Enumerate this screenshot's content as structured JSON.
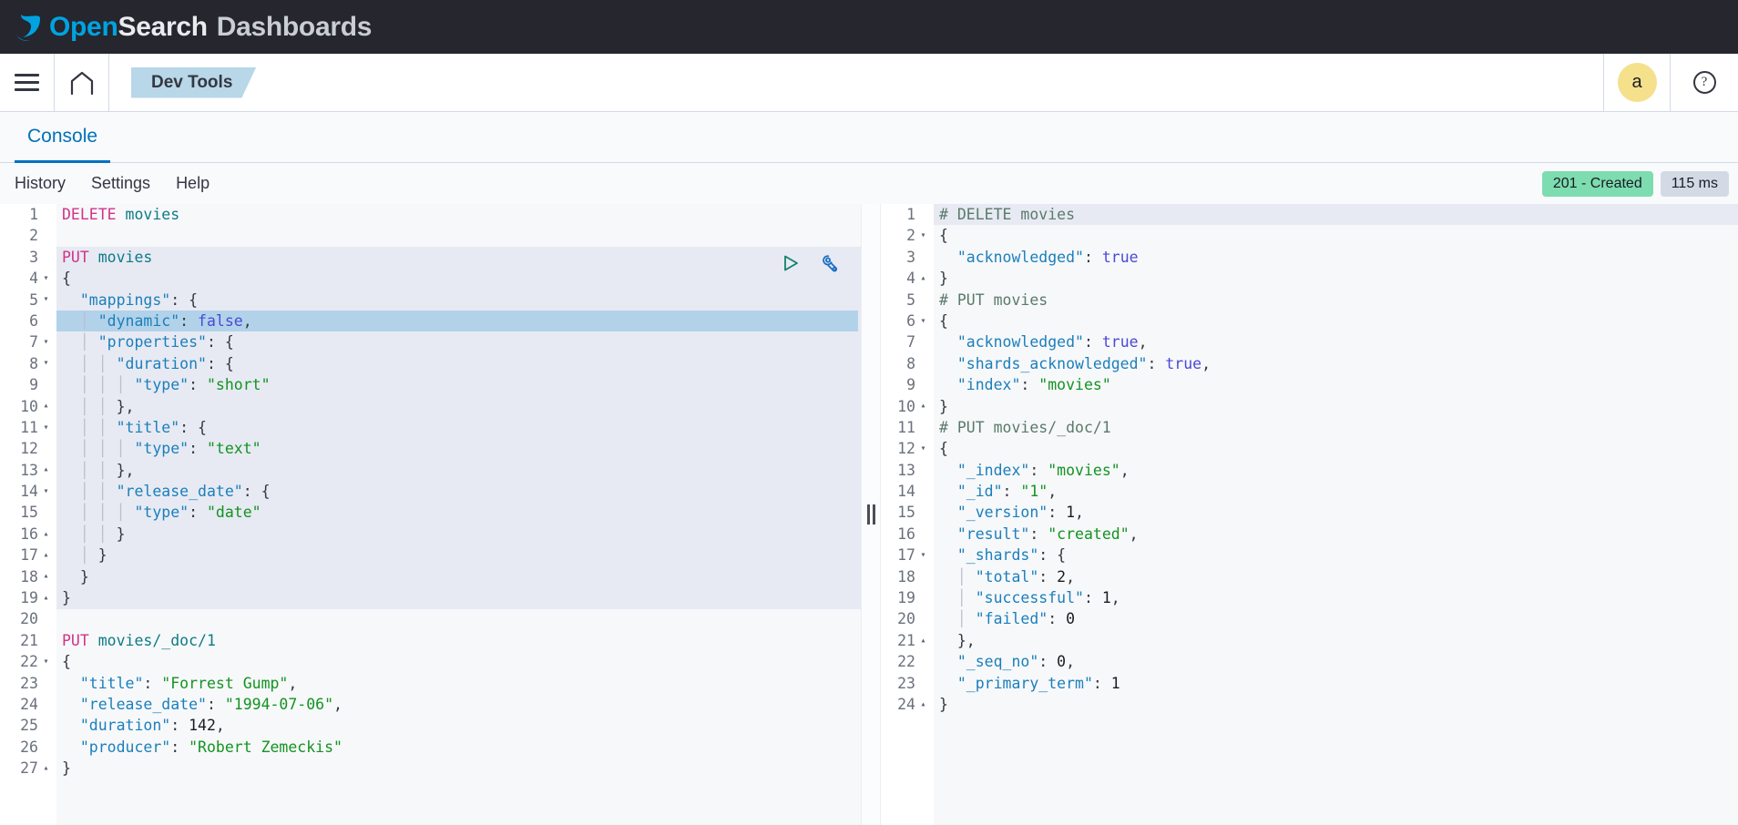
{
  "header": {
    "brand_open": "Open",
    "brand_search": "Search",
    "brand_dashboards": "Dashboards",
    "menu_icon": "hamburger-icon",
    "home_icon": "home-icon",
    "app_tab": "Dev Tools",
    "avatar_initial": "a",
    "help_icon": "question-mark-icon"
  },
  "tabs": [
    {
      "label": "Console",
      "active": true
    }
  ],
  "menu": {
    "items": [
      "History",
      "Settings",
      "Help"
    ],
    "status_badge": "201 - Created",
    "time_badge": "115 ms",
    "status_color": "#7ddcb0",
    "time_color": "#d3dae6"
  },
  "editor_actions": {
    "play_icon": "play-triangle-icon",
    "wrench_icon": "wrench-icon",
    "play_color": "#12806a",
    "wrench_color": "#1b6fc4"
  },
  "splitter": {
    "grip_icon": "drag-handle-icon"
  },
  "request_editor": {
    "name": "request-editor",
    "active_block_lines": [
      3,
      19
    ],
    "selected_line": 6,
    "active_gutter_line": 7,
    "lines": [
      {
        "n": 1,
        "fold": "",
        "tokens": [
          {
            "t": "DELETE",
            "c": "m"
          },
          {
            "t": " ",
            "c": "p"
          },
          {
            "t": "movies",
            "c": "u"
          }
        ]
      },
      {
        "n": 2,
        "fold": "",
        "tokens": []
      },
      {
        "n": 3,
        "fold": "",
        "tokens": [
          {
            "t": "PUT",
            "c": "m"
          },
          {
            "t": " ",
            "c": "p"
          },
          {
            "t": "movies",
            "c": "u"
          }
        ]
      },
      {
        "n": 4,
        "fold": "▾",
        "tokens": [
          {
            "t": "{",
            "c": "p"
          }
        ]
      },
      {
        "n": 5,
        "fold": "▾",
        "tokens": [
          {
            "t": "  ",
            "c": "p"
          },
          {
            "t": "\"mappings\"",
            "c": "k"
          },
          {
            "t": ": {",
            "c": "p"
          }
        ]
      },
      {
        "n": 6,
        "fold": "",
        "tokens": [
          {
            "t": "  ",
            "c": "p"
          },
          {
            "t": "│",
            "c": "ind"
          },
          {
            "t": " ",
            "c": "p"
          },
          {
            "t": "\"dynamic\"",
            "c": "k"
          },
          {
            "t": ": ",
            "c": "p"
          },
          {
            "t": "false",
            "c": "b"
          },
          {
            "t": ",",
            "c": "p"
          }
        ]
      },
      {
        "n": 7,
        "fold": "▾",
        "tokens": [
          {
            "t": "  ",
            "c": "p"
          },
          {
            "t": "│",
            "c": "ind"
          },
          {
            "t": " ",
            "c": "p"
          },
          {
            "t": "\"properties\"",
            "c": "k"
          },
          {
            "t": ": {",
            "c": "p"
          }
        ]
      },
      {
        "n": 8,
        "fold": "▾",
        "tokens": [
          {
            "t": "  ",
            "c": "p"
          },
          {
            "t": "│",
            "c": "ind"
          },
          {
            "t": " ",
            "c": "p"
          },
          {
            "t": "│",
            "c": "ind"
          },
          {
            "t": " ",
            "c": "p"
          },
          {
            "t": "\"duration\"",
            "c": "k"
          },
          {
            "t": ": {",
            "c": "p"
          }
        ]
      },
      {
        "n": 9,
        "fold": "",
        "tokens": [
          {
            "t": "  ",
            "c": "p"
          },
          {
            "t": "│",
            "c": "ind"
          },
          {
            "t": " ",
            "c": "p"
          },
          {
            "t": "│",
            "c": "ind"
          },
          {
            "t": " ",
            "c": "p"
          },
          {
            "t": "│",
            "c": "ind"
          },
          {
            "t": " ",
            "c": "p"
          },
          {
            "t": "\"type\"",
            "c": "k"
          },
          {
            "t": ": ",
            "c": "p"
          },
          {
            "t": "\"short\"",
            "c": "s"
          }
        ]
      },
      {
        "n": 10,
        "fold": "▴",
        "tokens": [
          {
            "t": "  ",
            "c": "p"
          },
          {
            "t": "│",
            "c": "ind"
          },
          {
            "t": " ",
            "c": "p"
          },
          {
            "t": "│",
            "c": "ind"
          },
          {
            "t": " ",
            "c": "p"
          },
          {
            "t": "},",
            "c": "p"
          }
        ]
      },
      {
        "n": 11,
        "fold": "▾",
        "tokens": [
          {
            "t": "  ",
            "c": "p"
          },
          {
            "t": "│",
            "c": "ind"
          },
          {
            "t": " ",
            "c": "p"
          },
          {
            "t": "│",
            "c": "ind"
          },
          {
            "t": " ",
            "c": "p"
          },
          {
            "t": "\"title\"",
            "c": "k"
          },
          {
            "t": ": {",
            "c": "p"
          }
        ]
      },
      {
        "n": 12,
        "fold": "",
        "tokens": [
          {
            "t": "  ",
            "c": "p"
          },
          {
            "t": "│",
            "c": "ind"
          },
          {
            "t": " ",
            "c": "p"
          },
          {
            "t": "│",
            "c": "ind"
          },
          {
            "t": " ",
            "c": "p"
          },
          {
            "t": "│",
            "c": "ind"
          },
          {
            "t": " ",
            "c": "p"
          },
          {
            "t": "\"type\"",
            "c": "k"
          },
          {
            "t": ": ",
            "c": "p"
          },
          {
            "t": "\"text\"",
            "c": "s"
          }
        ]
      },
      {
        "n": 13,
        "fold": "▴",
        "tokens": [
          {
            "t": "  ",
            "c": "p"
          },
          {
            "t": "│",
            "c": "ind"
          },
          {
            "t": " ",
            "c": "p"
          },
          {
            "t": "│",
            "c": "ind"
          },
          {
            "t": " ",
            "c": "p"
          },
          {
            "t": "},",
            "c": "p"
          }
        ]
      },
      {
        "n": 14,
        "fold": "▾",
        "tokens": [
          {
            "t": "  ",
            "c": "p"
          },
          {
            "t": "│",
            "c": "ind"
          },
          {
            "t": " ",
            "c": "p"
          },
          {
            "t": "│",
            "c": "ind"
          },
          {
            "t": " ",
            "c": "p"
          },
          {
            "t": "\"release_date\"",
            "c": "k"
          },
          {
            "t": ": {",
            "c": "p"
          }
        ]
      },
      {
        "n": 15,
        "fold": "",
        "tokens": [
          {
            "t": "  ",
            "c": "p"
          },
          {
            "t": "│",
            "c": "ind"
          },
          {
            "t": " ",
            "c": "p"
          },
          {
            "t": "│",
            "c": "ind"
          },
          {
            "t": " ",
            "c": "p"
          },
          {
            "t": "│",
            "c": "ind"
          },
          {
            "t": " ",
            "c": "p"
          },
          {
            "t": "\"type\"",
            "c": "k"
          },
          {
            "t": ": ",
            "c": "p"
          },
          {
            "t": "\"date\"",
            "c": "s"
          }
        ]
      },
      {
        "n": 16,
        "fold": "▴",
        "tokens": [
          {
            "t": "  ",
            "c": "p"
          },
          {
            "t": "│",
            "c": "ind"
          },
          {
            "t": " ",
            "c": "p"
          },
          {
            "t": "│",
            "c": "ind"
          },
          {
            "t": " ",
            "c": "p"
          },
          {
            "t": "}",
            "c": "p"
          }
        ]
      },
      {
        "n": 17,
        "fold": "▴",
        "tokens": [
          {
            "t": "  ",
            "c": "p"
          },
          {
            "t": "│",
            "c": "ind"
          },
          {
            "t": " ",
            "c": "p"
          },
          {
            "t": "}",
            "c": "p"
          }
        ]
      },
      {
        "n": 18,
        "fold": "▴",
        "tokens": [
          {
            "t": "  ",
            "c": "p"
          },
          {
            "t": "}",
            "c": "p"
          }
        ]
      },
      {
        "n": 19,
        "fold": "▴",
        "tokens": [
          {
            "t": "}",
            "c": "p"
          }
        ]
      },
      {
        "n": 20,
        "fold": "",
        "tokens": []
      },
      {
        "n": 21,
        "fold": "",
        "tokens": [
          {
            "t": "PUT",
            "c": "m"
          },
          {
            "t": " ",
            "c": "p"
          },
          {
            "t": "movies/_doc/1",
            "c": "u"
          }
        ]
      },
      {
        "n": 22,
        "fold": "▾",
        "tokens": [
          {
            "t": "{",
            "c": "p"
          }
        ]
      },
      {
        "n": 23,
        "fold": "",
        "tokens": [
          {
            "t": "  ",
            "c": "p"
          },
          {
            "t": "\"title\"",
            "c": "k"
          },
          {
            "t": ": ",
            "c": "p"
          },
          {
            "t": "\"Forrest Gump\"",
            "c": "s"
          },
          {
            "t": ",",
            "c": "p"
          }
        ]
      },
      {
        "n": 24,
        "fold": "",
        "tokens": [
          {
            "t": "  ",
            "c": "p"
          },
          {
            "t": "\"release_date\"",
            "c": "k"
          },
          {
            "t": ": ",
            "c": "p"
          },
          {
            "t": "\"1994-07-06\"",
            "c": "s"
          },
          {
            "t": ",",
            "c": "p"
          }
        ]
      },
      {
        "n": 25,
        "fold": "",
        "tokens": [
          {
            "t": "  ",
            "c": "p"
          },
          {
            "t": "\"duration\"",
            "c": "k"
          },
          {
            "t": ": ",
            "c": "p"
          },
          {
            "t": "142",
            "c": "n"
          },
          {
            "t": ",",
            "c": "p"
          }
        ]
      },
      {
        "n": 26,
        "fold": "",
        "tokens": [
          {
            "t": "  ",
            "c": "p"
          },
          {
            "t": "\"producer\"",
            "c": "k"
          },
          {
            "t": ": ",
            "c": "p"
          },
          {
            "t": "\"Robert Zemeckis\"",
            "c": "s"
          }
        ]
      },
      {
        "n": 27,
        "fold": "▴",
        "tokens": [
          {
            "t": "}",
            "c": "p"
          }
        ]
      }
    ]
  },
  "response_editor": {
    "name": "response-editor",
    "highlight_line": 1,
    "lines": [
      {
        "n": 1,
        "fold": "",
        "tokens": [
          {
            "t": "# DELETE movies",
            "c": "c"
          }
        ]
      },
      {
        "n": 2,
        "fold": "▾",
        "tokens": [
          {
            "t": "{",
            "c": "p"
          }
        ]
      },
      {
        "n": 3,
        "fold": "",
        "tokens": [
          {
            "t": "  ",
            "c": "p"
          },
          {
            "t": "\"acknowledged\"",
            "c": "k"
          },
          {
            "t": ": ",
            "c": "p"
          },
          {
            "t": "true",
            "c": "b"
          }
        ]
      },
      {
        "n": 4,
        "fold": "▴",
        "tokens": [
          {
            "t": "}",
            "c": "p"
          }
        ]
      },
      {
        "n": 5,
        "fold": "",
        "tokens": [
          {
            "t": "# PUT movies",
            "c": "c"
          }
        ]
      },
      {
        "n": 6,
        "fold": "▾",
        "tokens": [
          {
            "t": "{",
            "c": "p"
          }
        ]
      },
      {
        "n": 7,
        "fold": "",
        "tokens": [
          {
            "t": "  ",
            "c": "p"
          },
          {
            "t": "\"acknowledged\"",
            "c": "k"
          },
          {
            "t": ": ",
            "c": "p"
          },
          {
            "t": "true",
            "c": "b"
          },
          {
            "t": ",",
            "c": "p"
          }
        ]
      },
      {
        "n": 8,
        "fold": "",
        "tokens": [
          {
            "t": "  ",
            "c": "p"
          },
          {
            "t": "\"shards_acknowledged\"",
            "c": "k"
          },
          {
            "t": ": ",
            "c": "p"
          },
          {
            "t": "true",
            "c": "b"
          },
          {
            "t": ",",
            "c": "p"
          }
        ]
      },
      {
        "n": 9,
        "fold": "",
        "tokens": [
          {
            "t": "  ",
            "c": "p"
          },
          {
            "t": "\"index\"",
            "c": "k"
          },
          {
            "t": ": ",
            "c": "p"
          },
          {
            "t": "\"movies\"",
            "c": "s"
          }
        ]
      },
      {
        "n": 10,
        "fold": "▴",
        "tokens": [
          {
            "t": "}",
            "c": "p"
          }
        ]
      },
      {
        "n": 11,
        "fold": "",
        "tokens": [
          {
            "t": "# PUT movies/_doc/1",
            "c": "c"
          }
        ]
      },
      {
        "n": 12,
        "fold": "▾",
        "tokens": [
          {
            "t": "{",
            "c": "p"
          }
        ]
      },
      {
        "n": 13,
        "fold": "",
        "tokens": [
          {
            "t": "  ",
            "c": "p"
          },
          {
            "t": "\"_index\"",
            "c": "k"
          },
          {
            "t": ": ",
            "c": "p"
          },
          {
            "t": "\"movies\"",
            "c": "s"
          },
          {
            "t": ",",
            "c": "p"
          }
        ]
      },
      {
        "n": 14,
        "fold": "",
        "tokens": [
          {
            "t": "  ",
            "c": "p"
          },
          {
            "t": "\"_id\"",
            "c": "k"
          },
          {
            "t": ": ",
            "c": "p"
          },
          {
            "t": "\"1\"",
            "c": "s"
          },
          {
            "t": ",",
            "c": "p"
          }
        ]
      },
      {
        "n": 15,
        "fold": "",
        "tokens": [
          {
            "t": "  ",
            "c": "p"
          },
          {
            "t": "\"_version\"",
            "c": "k"
          },
          {
            "t": ": ",
            "c": "p"
          },
          {
            "t": "1",
            "c": "n"
          },
          {
            "t": ",",
            "c": "p"
          }
        ]
      },
      {
        "n": 16,
        "fold": "",
        "tokens": [
          {
            "t": "  ",
            "c": "p"
          },
          {
            "t": "\"result\"",
            "c": "k"
          },
          {
            "t": ": ",
            "c": "p"
          },
          {
            "t": "\"created\"",
            "c": "s"
          },
          {
            "t": ",",
            "c": "p"
          }
        ]
      },
      {
        "n": 17,
        "fold": "▾",
        "tokens": [
          {
            "t": "  ",
            "c": "p"
          },
          {
            "t": "\"_shards\"",
            "c": "k"
          },
          {
            "t": ": {",
            "c": "p"
          }
        ]
      },
      {
        "n": 18,
        "fold": "",
        "tokens": [
          {
            "t": "  ",
            "c": "p"
          },
          {
            "t": "│",
            "c": "ind"
          },
          {
            "t": " ",
            "c": "p"
          },
          {
            "t": "\"total\"",
            "c": "k"
          },
          {
            "t": ": ",
            "c": "p"
          },
          {
            "t": "2",
            "c": "n"
          },
          {
            "t": ",",
            "c": "p"
          }
        ]
      },
      {
        "n": 19,
        "fold": "",
        "tokens": [
          {
            "t": "  ",
            "c": "p"
          },
          {
            "t": "│",
            "c": "ind"
          },
          {
            "t": " ",
            "c": "p"
          },
          {
            "t": "\"successful\"",
            "c": "k"
          },
          {
            "t": ": ",
            "c": "p"
          },
          {
            "t": "1",
            "c": "n"
          },
          {
            "t": ",",
            "c": "p"
          }
        ]
      },
      {
        "n": 20,
        "fold": "",
        "tokens": [
          {
            "t": "  ",
            "c": "p"
          },
          {
            "t": "│",
            "c": "ind"
          },
          {
            "t": " ",
            "c": "p"
          },
          {
            "t": "\"failed\"",
            "c": "k"
          },
          {
            "t": ": ",
            "c": "p"
          },
          {
            "t": "0",
            "c": "n"
          }
        ]
      },
      {
        "n": 21,
        "fold": "▴",
        "tokens": [
          {
            "t": "  ",
            "c": "p"
          },
          {
            "t": "},",
            "c": "p"
          }
        ]
      },
      {
        "n": 22,
        "fold": "",
        "tokens": [
          {
            "t": "  ",
            "c": "p"
          },
          {
            "t": "\"_seq_no\"",
            "c": "k"
          },
          {
            "t": ": ",
            "c": "p"
          },
          {
            "t": "0",
            "c": "n"
          },
          {
            "t": ",",
            "c": "p"
          }
        ]
      },
      {
        "n": 23,
        "fold": "",
        "tokens": [
          {
            "t": "  ",
            "c": "p"
          },
          {
            "t": "\"_primary_term\"",
            "c": "k"
          },
          {
            "t": ": ",
            "c": "p"
          },
          {
            "t": "1",
            "c": "n"
          }
        ]
      },
      {
        "n": 24,
        "fold": "▴",
        "tokens": [
          {
            "t": "}",
            "c": "p"
          }
        ]
      }
    ]
  }
}
